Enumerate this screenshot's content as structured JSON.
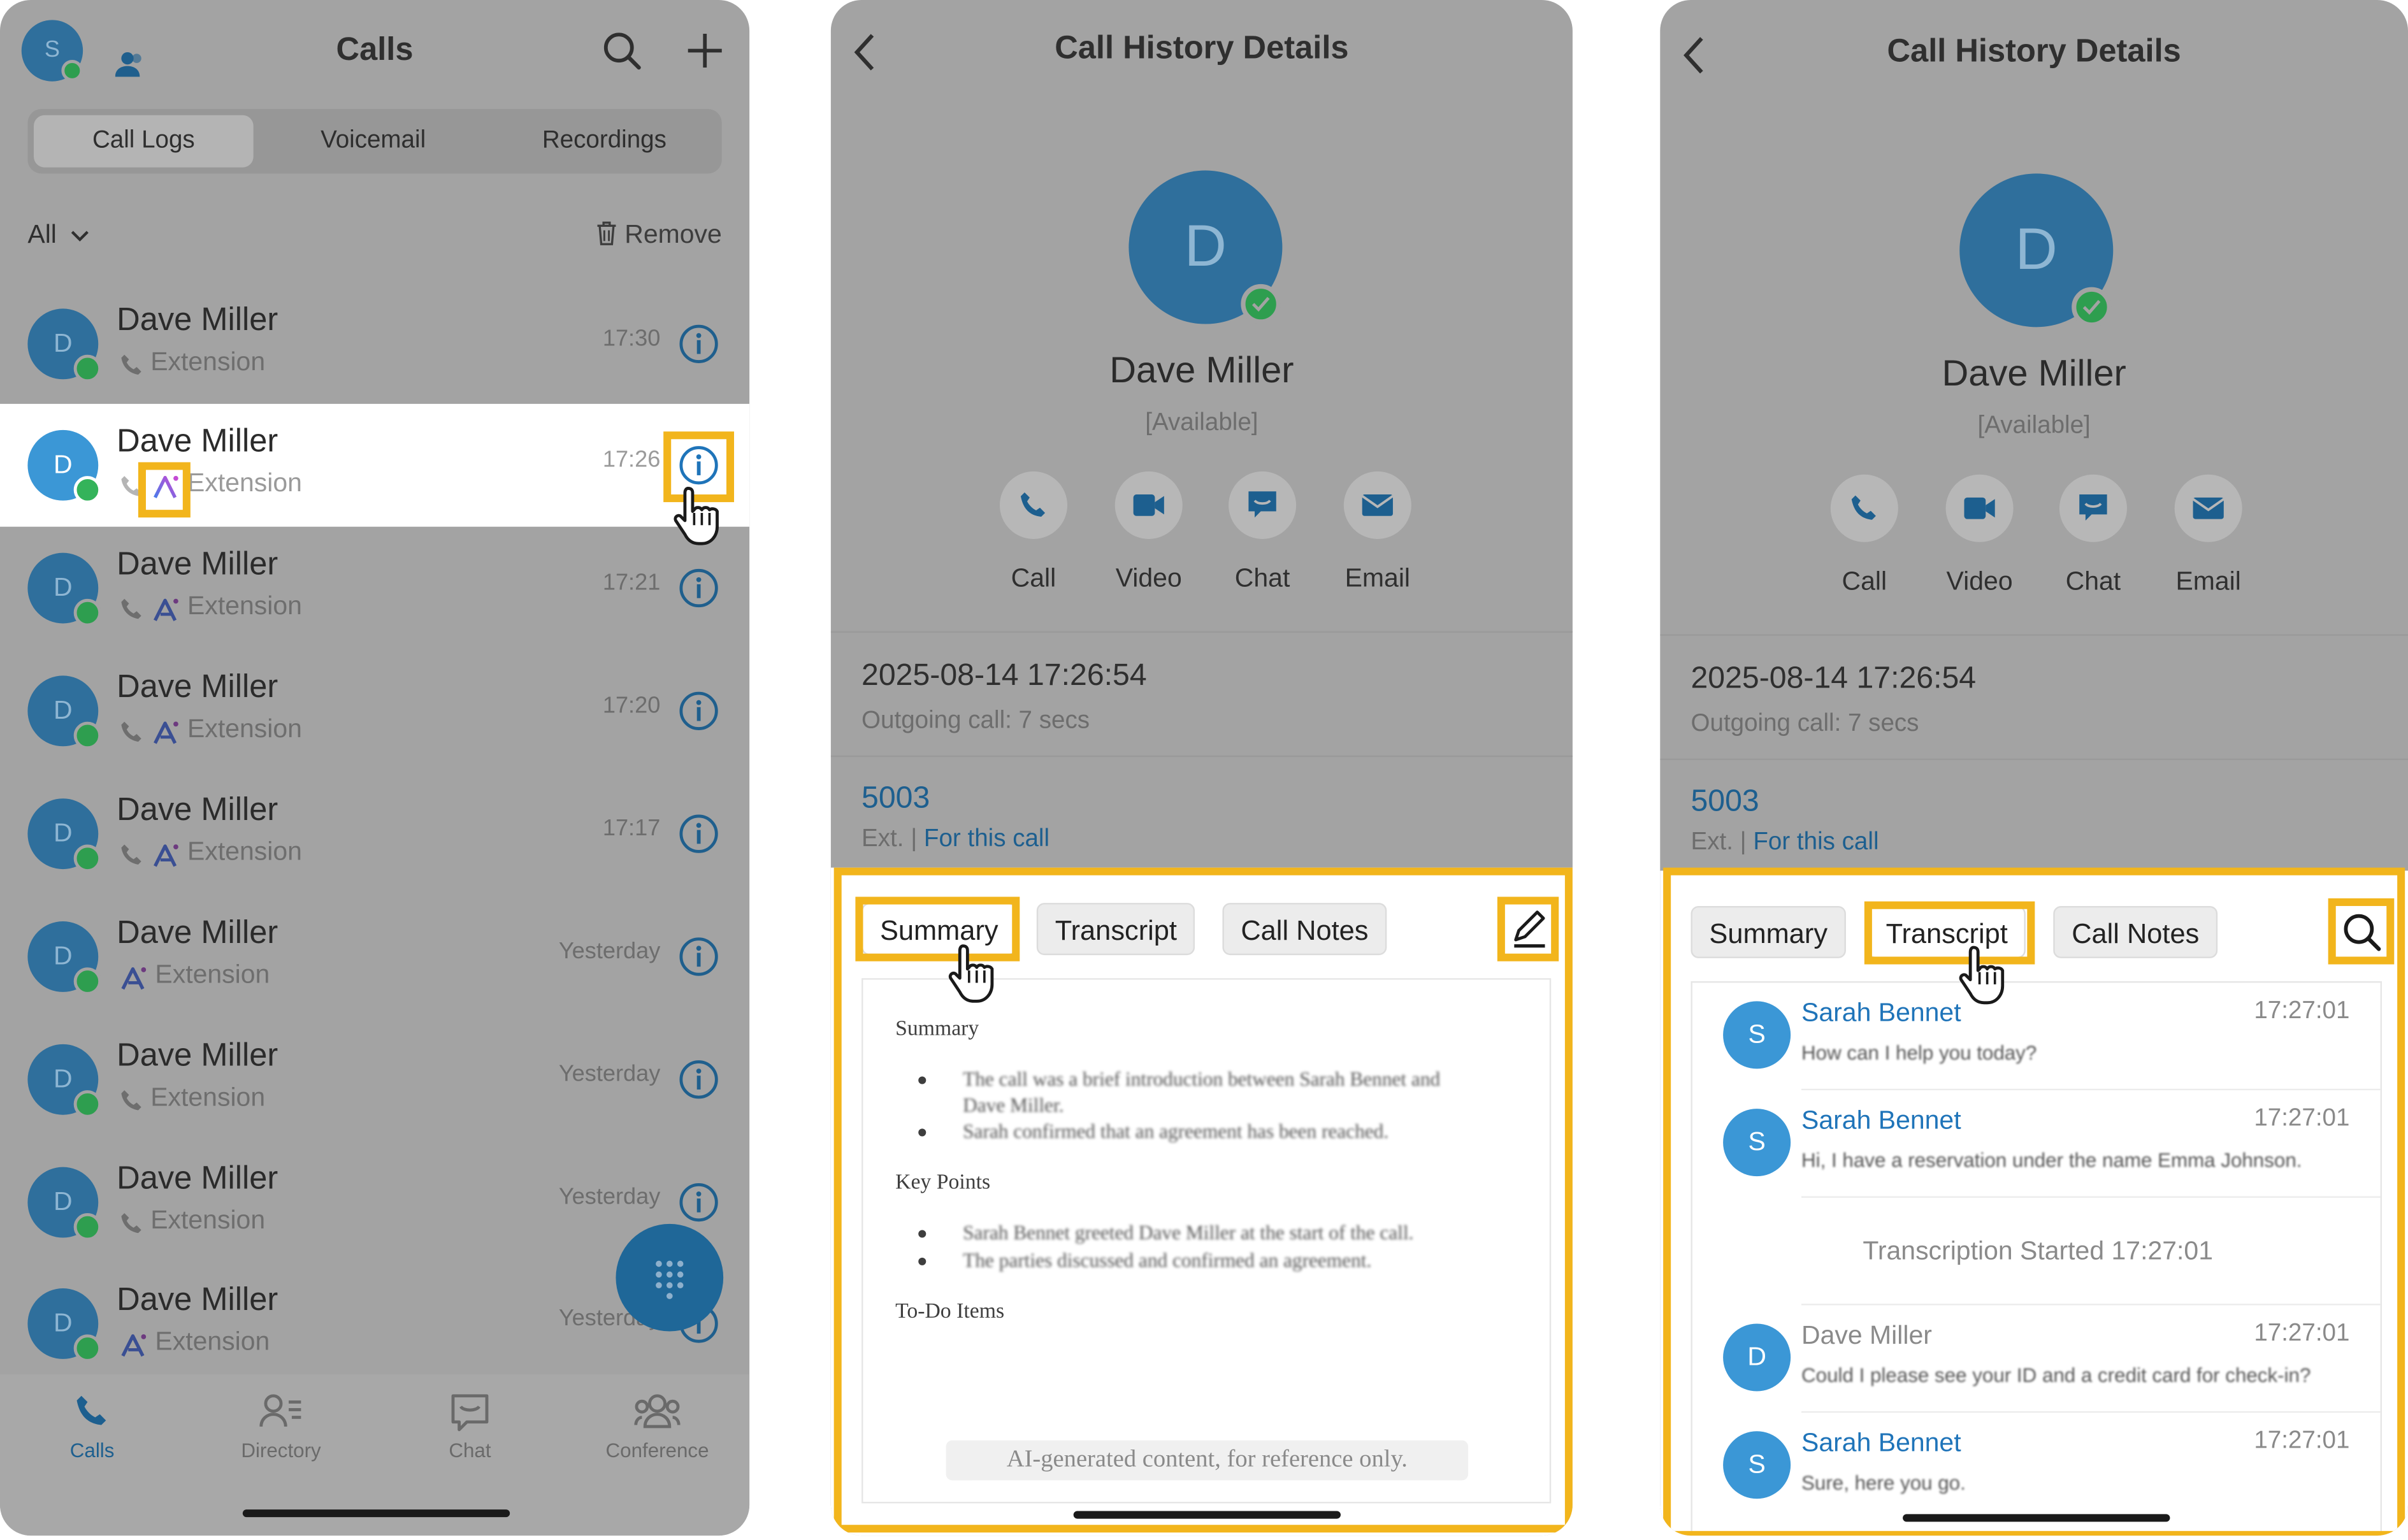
{
  "calls": {
    "avatar_letter": "S",
    "title": "Calls",
    "segments": [
      "Call Logs",
      "Voicemail",
      "Recordings"
    ],
    "filter": "All",
    "remove": "Remove",
    "rows": [
      {
        "letter": "D",
        "name": "Dave Miller",
        "type": "Extension",
        "time": "17:30",
        "ai": false
      },
      {
        "letter": "D",
        "name": "Dave Miller",
        "type": "Extension",
        "time": "17:26",
        "ai": true
      },
      {
        "letter": "D",
        "name": "Dave Miller",
        "type": "Extension",
        "time": "17:21",
        "ai": true
      },
      {
        "letter": "D",
        "name": "Dave Miller",
        "type": "Extension",
        "time": "17:20",
        "ai": true
      },
      {
        "letter": "D",
        "name": "Dave Miller",
        "type": "Extension",
        "time": "17:17",
        "ai": true
      },
      {
        "letter": "D",
        "name": "Dave Miller",
        "type": "Extension",
        "time": "Yesterday",
        "ai": true
      },
      {
        "letter": "D",
        "name": "Dave Miller",
        "type": "Extension",
        "time": "Yesterday",
        "ai": false
      },
      {
        "letter": "D",
        "name": "Dave Miller",
        "type": "Extension",
        "time": "Yesterday",
        "ai": false
      },
      {
        "letter": "D",
        "name": "Dave Miller",
        "type": "Extension",
        "time": "Yesterday",
        "ai": true
      }
    ],
    "tabs": [
      "Calls",
      "Directory",
      "Chat",
      "Conference"
    ]
  },
  "details": {
    "title": "Call History Details",
    "avatar_letter": "D",
    "name": "Dave Miller",
    "status": "[Available]",
    "actions": [
      "Call",
      "Video",
      "Chat",
      "Email"
    ],
    "datetime": "2025-08-14 17:26:54",
    "call_info": "Outgoing call:  7 secs",
    "ext_number": "5003",
    "ext_label": "Ext.",
    "ext_link": "For this call",
    "tabs": [
      "Summary",
      "Transcript",
      "Call Notes"
    ]
  },
  "summary": {
    "h1": "Summary",
    "p1": "The call was a brief introduction between Sarah Bennet and",
    "p1b": "Dave Miller.",
    "p2": "Sarah confirmed that an agreement has been reached.",
    "h2": "Key Points",
    "k1": "Sarah Bennet greeted Dave Miller at the start of the call.",
    "k2": "The parties discussed and confirmed an agreement.",
    "h3": "To-Do Items",
    "ai_notice": "AI-generated content, for reference only."
  },
  "transcript": {
    "messages": [
      {
        "letter": "S",
        "name": "Sarah Bennet",
        "time": "17:27:01",
        "text": "How can I help you today?"
      },
      {
        "letter": "S",
        "name": "Sarah Bennet",
        "time": "17:27:01",
        "text": "Hi, I have a reservation under the name Emma Johnson."
      },
      {
        "letter": "D",
        "name": "Dave Miller",
        "time": "17:27:01",
        "text": "Could I please see your ID and a credit card for check-in?"
      },
      {
        "letter": "S",
        "name": "Sarah Bennet",
        "time": "17:27:01",
        "text": "Sure, here you go."
      }
    ],
    "started": "Transcription Started 17:27:01"
  },
  "colors": {
    "highlight": "#f2b51c",
    "accent": "#1f74b9",
    "presence": "#34b35a"
  }
}
